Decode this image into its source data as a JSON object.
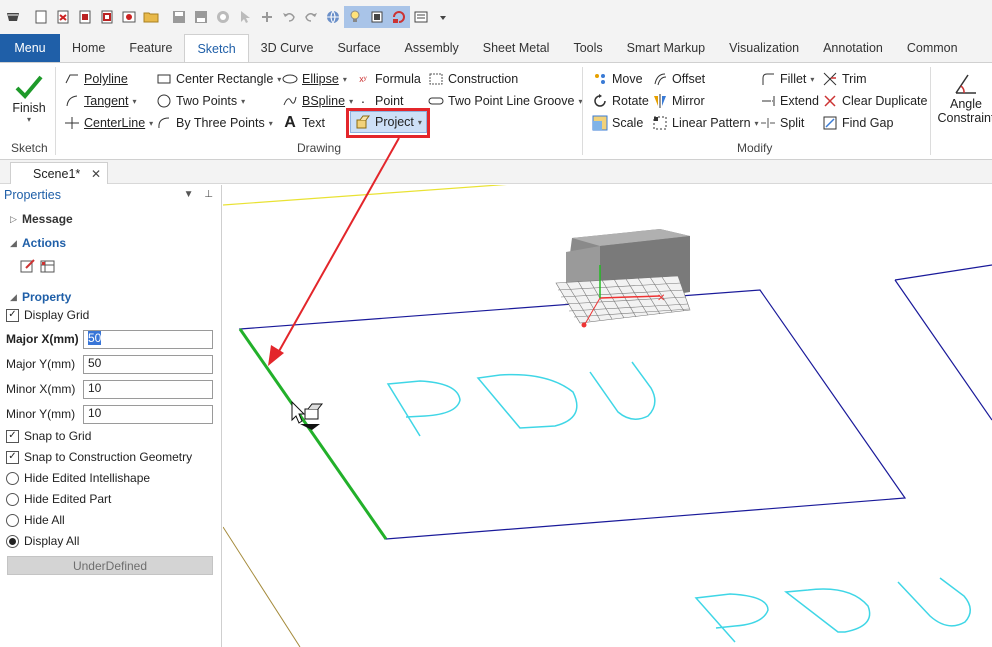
{
  "ribbon_tabs": [
    "Menu",
    "Home",
    "Feature",
    "Sketch",
    "3D Curve",
    "Surface",
    "Assembly",
    "Sheet Metal",
    "Tools",
    "Smart Markup",
    "Visualization",
    "Annotation",
    "Common"
  ],
  "active_tab": "Sketch",
  "sketch_group": {
    "finish_label": "Finish",
    "group_label": "Sketch"
  },
  "drawing_group": {
    "label": "Drawing",
    "polyline": "Polyline",
    "tangent": "Tangent",
    "centerline": "CenterLine",
    "center_rectangle": "Center Rectangle",
    "two_points": "Two Points",
    "by_three_points": "By Three Points",
    "ellipse": "Ellipse",
    "bspline": "BSpline",
    "text": "Text",
    "formula": "Formula",
    "point": "Point",
    "project": "Project",
    "construction": "Construction",
    "two_point_line_groove": "Two Point Line Groove"
  },
  "modify_group": {
    "label": "Modify",
    "move": "Move",
    "rotate": "Rotate",
    "scale": "Scale",
    "offset": "Offset",
    "mirror": "Mirror",
    "linear_pattern": "Linear Pattern",
    "fillet": "Fillet",
    "extend": "Extend",
    "split": "Split",
    "trim": "Trim",
    "clear_duplicate": "Clear Duplicate",
    "find_gap": "Find Gap"
  },
  "constraint_group": {
    "angle_line1": "Angle",
    "angle_line2": "Constraint"
  },
  "document_tab": "Scene1*",
  "properties": {
    "title": "Properties",
    "message_label": "Message",
    "actions_label": "Actions",
    "property_label": "Property",
    "display_grid": {
      "label": "Display Grid",
      "checked": true
    },
    "major_x": {
      "label": "Major X(mm)",
      "value": "50"
    },
    "major_y": {
      "label": "Major Y(mm)",
      "value": "50"
    },
    "minor_x": {
      "label": "Minor X(mm)",
      "value": "10"
    },
    "minor_y": {
      "label": "Minor Y(mm)",
      "value": "10"
    },
    "snap_to_grid": {
      "label": "Snap to Grid",
      "checked": true
    },
    "snap_to_construction": {
      "label": "Snap to Construction Geometry",
      "checked": true
    },
    "hide_edited_intellishape": "Hide Edited Intellishape",
    "hide_edited_part": "Hide Edited Part",
    "hide_all": "Hide All",
    "display_all": "Display All",
    "status_button": "UnderDefined"
  },
  "viewport": {
    "sketch_text_1": "PDU",
    "sketch_text_2": "PDU"
  },
  "colors": {
    "accent": "#1f5fa8",
    "highlight_red": "#e3262b",
    "edge_green": "#22b02a",
    "sketch_cyan": "#3fd6e6",
    "plane_blue": "#1a1a9a"
  }
}
